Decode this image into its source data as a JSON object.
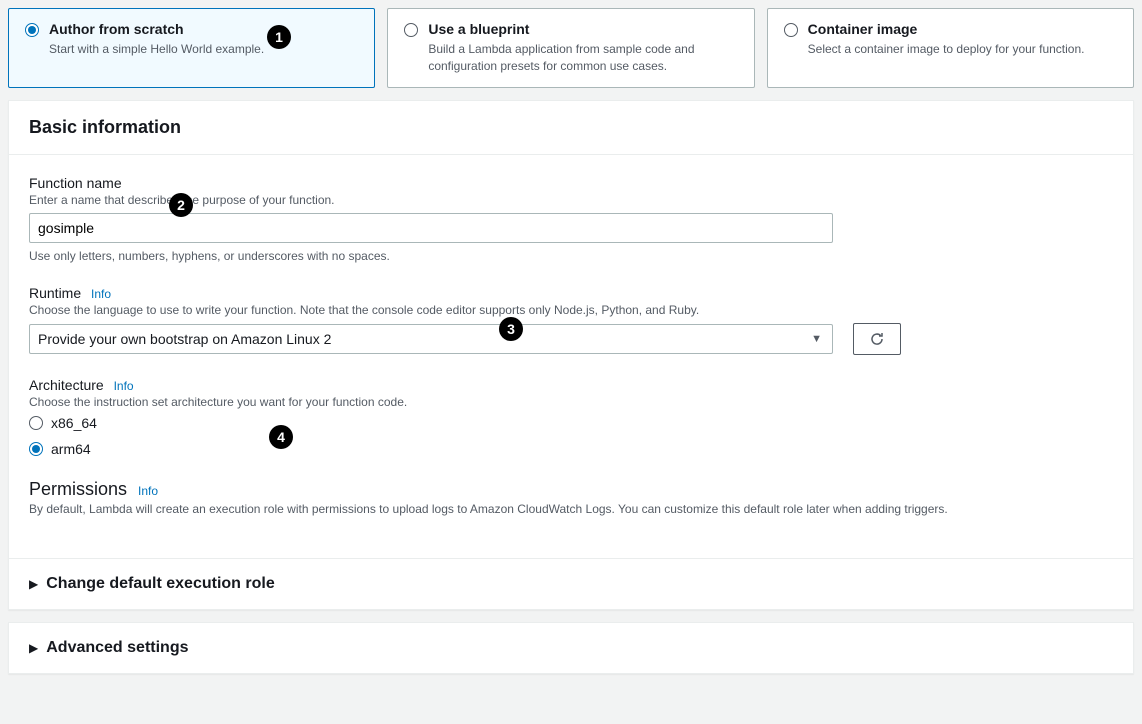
{
  "options": [
    {
      "title": "Author from scratch",
      "desc": "Start with a simple Hello World example.",
      "selected": true
    },
    {
      "title": "Use a blueprint",
      "desc": "Build a Lambda application from sample code and configuration presets for common use cases.",
      "selected": false
    },
    {
      "title": "Container image",
      "desc": "Select a container image to deploy for your function.",
      "selected": false
    }
  ],
  "basic": {
    "title": "Basic information",
    "function_name": {
      "label": "Function name",
      "desc": "Enter a name that describes the purpose of your function.",
      "value": "gosimple",
      "hint": "Use only letters, numbers, hyphens, or underscores with no spaces."
    },
    "runtime": {
      "label": "Runtime",
      "info": "Info",
      "desc": "Choose the language to use to write your function. Note that the console code editor supports only Node.js, Python, and Ruby.",
      "value": "Provide your own bootstrap on Amazon Linux 2"
    },
    "architecture": {
      "label": "Architecture",
      "info": "Info",
      "desc": "Choose the instruction set architecture you want for your function code.",
      "options": [
        "x86_64",
        "arm64"
      ],
      "selected": "arm64"
    },
    "permissions": {
      "label": "Permissions",
      "info": "Info",
      "desc": "By default, Lambda will create an execution role with permissions to upload logs to Amazon CloudWatch Logs. You can customize this default role later when adding triggers."
    },
    "change_role": "Change default execution role"
  },
  "advanced": {
    "title": "Advanced settings"
  },
  "annotations": [
    "1",
    "2",
    "3",
    "4"
  ]
}
